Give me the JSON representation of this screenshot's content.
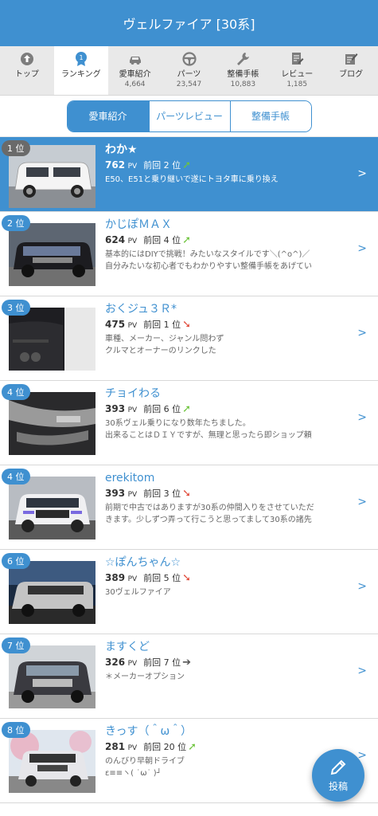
{
  "header": {
    "title": "ヴェルファイア [30系]"
  },
  "tabs": [
    {
      "label": "トップ",
      "count": "",
      "icon": "top-icon"
    },
    {
      "label": "ランキング",
      "count": "",
      "icon": "ranking-icon"
    },
    {
      "label": "愛車紹介",
      "count": "4,664",
      "icon": "car-icon"
    },
    {
      "label": "パーツ",
      "count": "23,547",
      "icon": "steering-icon"
    },
    {
      "label": "整備手帳",
      "count": "10,883",
      "icon": "wrench-icon"
    },
    {
      "label": "レビュー",
      "count": "1,185",
      "icon": "review-icon"
    },
    {
      "label": "ブログ",
      "count": "",
      "icon": "blog-icon"
    }
  ],
  "segments": [
    "愛車紹介",
    "パーツレビュー",
    "整備手帳"
  ],
  "items": [
    {
      "rank": "1 位",
      "name": "わか★",
      "pv": "762",
      "pv_unit": "PV",
      "prev": "前回 2 位",
      "trend": "up",
      "desc1": "E50、E51と乗り継いで遂にトヨタ車に乗り換え",
      "desc2": ""
    },
    {
      "rank": "2 位",
      "name": "かじぽＭＡＸ",
      "pv": "624",
      "pv_unit": "PV",
      "prev": "前回 4 位",
      "trend": "up",
      "desc1": "基本的にはDIYで挑戦！みたいなスタイルです＼(^o^)／",
      "desc2": "自分みたいな初心者でもわかりやすい整備手帳をあげてい"
    },
    {
      "rank": "3 位",
      "name": "おくジュ３Ｒ*",
      "pv": "475",
      "pv_unit": "PV",
      "prev": "前回 1 位",
      "trend": "down",
      "desc1": "車種、メーカー、ジャンル問わず",
      "desc2": "クルマとオーナーのリンクした"
    },
    {
      "rank": "4 位",
      "name": "チョイわる",
      "pv": "393",
      "pv_unit": "PV",
      "prev": "前回 6 位",
      "trend": "up",
      "desc1": "30系ヴェル乗りになり数年たちました。",
      "desc2": "出来ることはＤＩＹですが、無理と思ったら即ショップ頼"
    },
    {
      "rank": "4 位",
      "name": "erekitom",
      "pv": "393",
      "pv_unit": "PV",
      "prev": "前回 3 位",
      "trend": "down",
      "desc1": "前期で中古ではありますが30系の仲間入りをさせていただ",
      "desc2": "きます。少しずつ弄って行こうと思ってまして30系の諸先"
    },
    {
      "rank": "6 位",
      "name": "☆ぽんちゃん☆",
      "pv": "389",
      "pv_unit": "PV",
      "prev": "前回 5 位",
      "trend": "down",
      "desc1": "30ヴェルファイア",
      "desc2": ""
    },
    {
      "rank": "7 位",
      "name": "ますくど",
      "pv": "326",
      "pv_unit": "PV",
      "prev": "前回 7 位",
      "trend": "flat",
      "desc1": "＊メーカーオプション",
      "desc2": ""
    },
    {
      "rank": "8 位",
      "name": "きっす（＾ω＾）",
      "pv": "281",
      "pv_unit": "PV",
      "prev": "前回 20 位",
      "trend": "up",
      "desc1": "のんびり早朝ドライブ",
      "desc2": "ε≡≡ヽ( ˙ω˙ )┘"
    }
  ],
  "fab": {
    "label": "投稿"
  },
  "colors": {
    "primary": "#3f90d0",
    "up": "#6ec43d",
    "down": "#e14b3b"
  }
}
